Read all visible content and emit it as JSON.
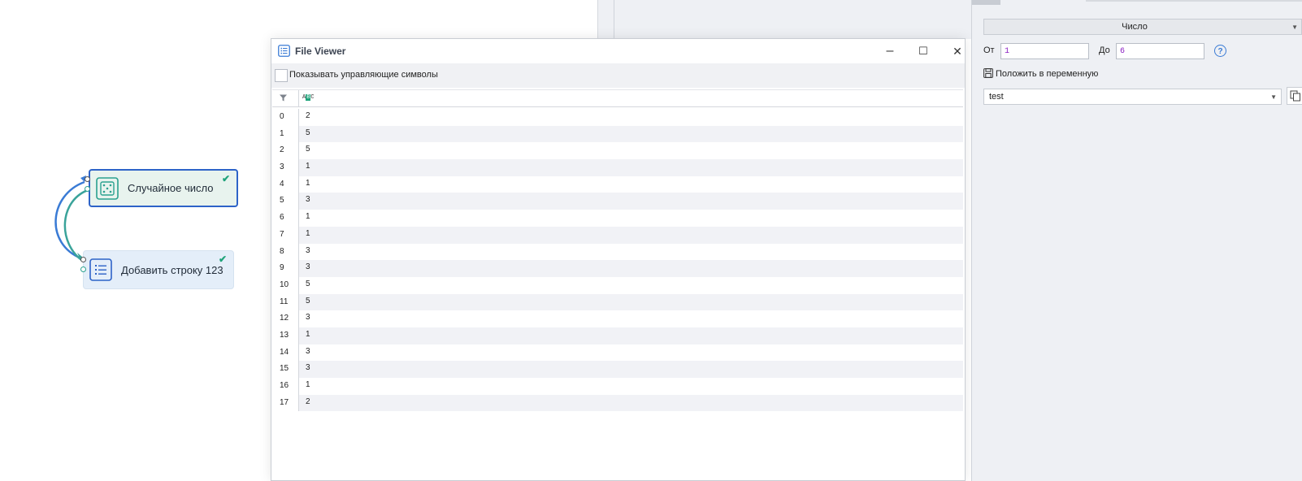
{
  "canvas": {
    "nodes": [
      {
        "label": "Случайное число",
        "icon": "dice-icon",
        "status": "check-icon"
      },
      {
        "label": "Добавить строку 123",
        "icon": "list-icon",
        "status": "check-icon"
      }
    ],
    "colors": {
      "selected_border": "#2d63c8",
      "link": "#3a7bd5",
      "link_alt": "#3aa39a",
      "check": "#1fa37a"
    }
  },
  "file_viewer": {
    "title": "File Viewer",
    "controls": {
      "minimize": "–",
      "maximize": "☐",
      "close": "✕"
    },
    "show_control_chars_label": "Показывать управляющие символы",
    "column_type_icon": "text-type-icon",
    "rows": [
      {
        "index": "0",
        "value": "2"
      },
      {
        "index": "1",
        "value": "5"
      },
      {
        "index": "2",
        "value": "5"
      },
      {
        "index": "3",
        "value": "1"
      },
      {
        "index": "4",
        "value": "1"
      },
      {
        "index": "5",
        "value": "3"
      },
      {
        "index": "6",
        "value": "1"
      },
      {
        "index": "7",
        "value": "1"
      },
      {
        "index": "8",
        "value": "3"
      },
      {
        "index": "9",
        "value": "3"
      },
      {
        "index": "10",
        "value": "5"
      },
      {
        "index": "11",
        "value": "5"
      },
      {
        "index": "12",
        "value": "3"
      },
      {
        "index": "13",
        "value": "1"
      },
      {
        "index": "14",
        "value": "3"
      },
      {
        "index": "15",
        "value": "3"
      },
      {
        "index": "16",
        "value": "1"
      },
      {
        "index": "17",
        "value": "2"
      }
    ]
  },
  "properties": {
    "type_select": "Число",
    "from_label": "От",
    "from_value": "1",
    "to_label": "До",
    "to_value": "6",
    "save_to_var_label": "Положить в переменную",
    "variable": "test"
  }
}
